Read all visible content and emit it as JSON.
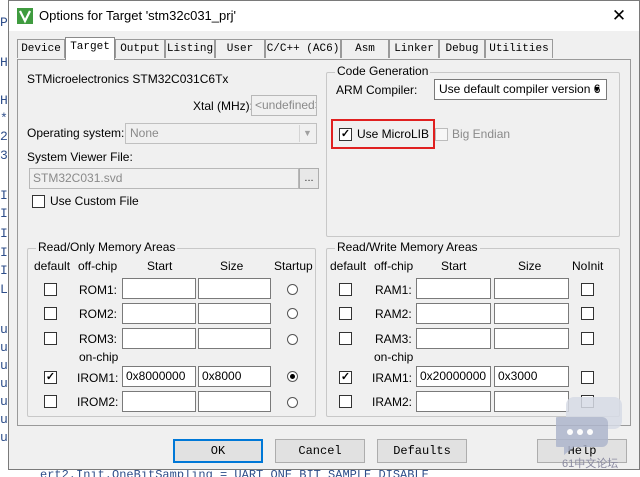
{
  "window": {
    "title": "Options for Target 'stm32c031_prj'"
  },
  "tabs": [
    {
      "label": "Device"
    },
    {
      "label": "Target"
    },
    {
      "label": "Output"
    },
    {
      "label": "Listing"
    },
    {
      "label": "User"
    },
    {
      "label": "C/C++ (AC6)"
    },
    {
      "label": "Asm"
    },
    {
      "label": "Linker"
    },
    {
      "label": "Debug"
    },
    {
      "label": "Utilities"
    }
  ],
  "active_tab": "Target",
  "target": {
    "device_name": "STMicroelectronics STM32C031C6Tx",
    "xtal_label": "Xtal (MHz):",
    "xtal_value": "<undefined>",
    "os_label": "Operating system:",
    "os_value": "None",
    "svd_label": "System Viewer File:",
    "svd_value": "STM32C031.svd",
    "browse_label": "...",
    "custom_file_label": "Use Custom File",
    "custom_file_checked": false
  },
  "code_generation": {
    "title": "Code Generation",
    "compiler_label": "ARM Compiler:",
    "compiler_value": "Use default compiler version 6",
    "microlib_label": "Use MicroLIB",
    "microlib_checked": true,
    "big_endian_label": "Big Endian",
    "big_endian_checked": false
  },
  "ro_memory": {
    "title": "Read/Only Memory Areas",
    "headers": {
      "default": "default",
      "offchip": "off-chip",
      "start": "Start",
      "size": "Size",
      "startup": "Startup"
    },
    "onchip_label": "on-chip",
    "rows": [
      {
        "name": "ROM1:",
        "start": "",
        "size": "",
        "default": false,
        "startup": false
      },
      {
        "name": "ROM2:",
        "start": "",
        "size": "",
        "default": false,
        "startup": false
      },
      {
        "name": "ROM3:",
        "start": "",
        "size": "",
        "default": false,
        "startup": false
      },
      {
        "name": "IROM1:",
        "start": "0x8000000",
        "size": "0x8000",
        "default": true,
        "startup": true
      },
      {
        "name": "IROM2:",
        "start": "",
        "size": "",
        "default": false,
        "startup": false
      }
    ]
  },
  "rw_memory": {
    "title": "Read/Write Memory Areas",
    "headers": {
      "default": "default",
      "offchip": "off-chip",
      "start": "Start",
      "size": "Size",
      "noinit": "NoInit"
    },
    "onchip_label": "on-chip",
    "rows": [
      {
        "name": "RAM1:",
        "start": "",
        "size": "",
        "default": false,
        "noinit": false
      },
      {
        "name": "RAM2:",
        "start": "",
        "size": "",
        "default": false,
        "noinit": false
      },
      {
        "name": "RAM3:",
        "start": "",
        "size": "",
        "default": false,
        "noinit": false
      },
      {
        "name": "IRAM1:",
        "start": "0x20000000",
        "size": "0x3000",
        "default": true,
        "noinit": false
      },
      {
        "name": "IRAM2:",
        "start": "",
        "size": "",
        "default": false,
        "noinit": false
      }
    ]
  },
  "buttons": {
    "ok": "OK",
    "cancel": "Cancel",
    "defaults": "Defaults",
    "help": "Help"
  },
  "background_editor": {
    "chars": [
      "P",
      "H",
      "H",
      "*",
      "2",
      "3",
      "I",
      "I",
      "I",
      "I",
      "I",
      "L",
      "u",
      "u",
      "u",
      "u",
      "u",
      "u",
      "u"
    ],
    "bottom_line": "ert2.Init.OneBitSampling = UART_ONE_BIT_SAMPLE_DISABLE"
  },
  "watermark": {
    "text": "61中文论坛"
  },
  "colors": {
    "highlight": "#e02020",
    "title_bar": "#ffffff",
    "dialog_bg": "#f0f0f0"
  }
}
